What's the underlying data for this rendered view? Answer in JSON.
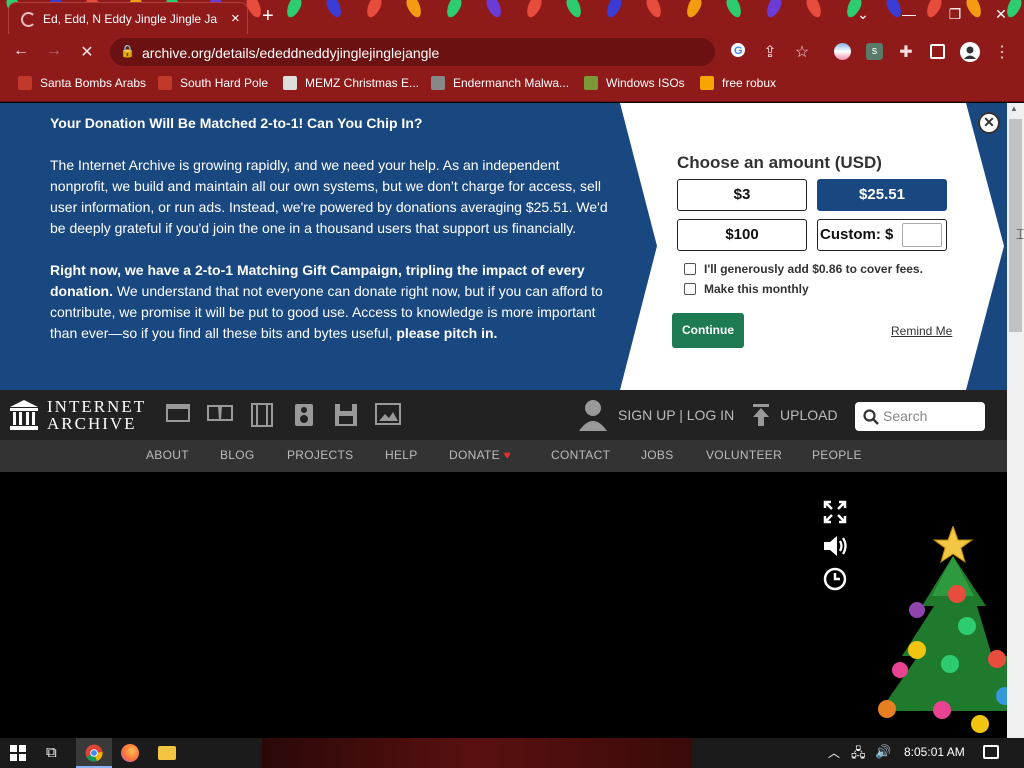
{
  "browser": {
    "tab_title": "Ed, Edd, N Eddy Jingle Jingle Jangle",
    "tab_close": "×",
    "new_tab": "+",
    "url": "archive.org/details/ededdneddyjinglejinglejangle",
    "window_controls": {
      "chevron": "⌄",
      "minimize": "—",
      "restore": "❐",
      "close": "✕"
    },
    "bookmarks": [
      {
        "label": "Santa Bombs Arabs",
        "icon": "santa-icon",
        "color": "#c0392b"
      },
      {
        "label": "South Hard Pole",
        "icon": "snowflake-icon",
        "color": "#c0392b"
      },
      {
        "label": "MEMZ Christmas E...",
        "icon": "page-icon",
        "color": "#dddddd"
      },
      {
        "label": "Endermanch Malwa...",
        "icon": "raccoon-icon",
        "color": "#888888"
      },
      {
        "label": "Windows ISOs",
        "icon": "tree-icon",
        "color": "#7a9a3a"
      },
      {
        "label": "free robux",
        "icon": "ph-icon",
        "color": "#f7a400"
      }
    ]
  },
  "banner": {
    "heading": "Your Donation Will Be Matched 2-to-1! Can You Chip In?",
    "para1": "The Internet Archive is growing rapidly, and we need your help. As an independent nonprofit, we build and maintain all our own systems, but we don’t charge for access, sell user information, or run ads. Instead, we're powered by donations averaging $25.51. We'd be deeply grateful if you'd join the one in a thousand users that support us financially.",
    "para2_bold": "Right now, we have a 2-to-1 Matching Gift Campaign, tripling the impact of every donation.",
    "para2_rest": " We understand that not everyone can donate right now, but if you can afford to contribute, we promise it will be put to good use. Access to knowledge is more important than ever—so if you find all these bits and bytes useful, ",
    "para2_end": "please pitch in.",
    "choose_label": "Choose an amount (USD)",
    "amounts": [
      "$3",
      "$25.51",
      "$100"
    ],
    "selected_amount": "$25.51",
    "custom_label": "Custom: $",
    "custom_value": "",
    "cover_fees": "I'll generously add $0.86 to cover fees.",
    "monthly": "Make this monthly",
    "continue": "Continue",
    "remind": "Remind Me",
    "close": "✕",
    "colors": {
      "blue": "#194880",
      "green": "#1d7a52"
    }
  },
  "ia": {
    "logo_line1": "INTERNET",
    "logo_line2": "ARCHIVE",
    "signup": "SIGN UP | LOG IN",
    "upload": "UPLOAD",
    "search_placeholder": "Search",
    "menu": [
      "ABOUT",
      "BLOG",
      "PROJECTS",
      "HELP",
      "DONATE",
      "CONTACT",
      "JOBS",
      "VOLUNTEER",
      "PEOPLE"
    ]
  },
  "taskbar": {
    "clock": "8:05:01 AM"
  }
}
